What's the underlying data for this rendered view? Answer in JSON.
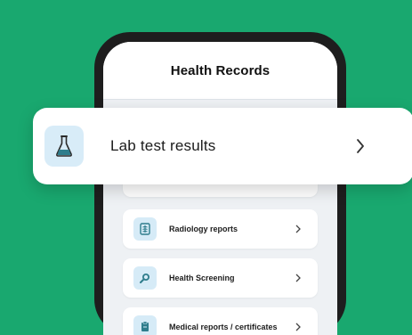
{
  "colors": {
    "background": "#19a86f",
    "phone_frame": "#1e1e1e",
    "icon_tile": "#d6ebf7",
    "icon_accent": "#2f7d8c"
  },
  "header": {
    "title": "Health Records"
  },
  "featured_item": {
    "label": "Lab test results",
    "icon": "flask-icon"
  },
  "list": {
    "items": [
      {
        "label": "Radiology reports",
        "icon": "xray-icon"
      },
      {
        "label": "Health Screening",
        "icon": "magnifier-icon"
      },
      {
        "label": "Medical reports / certificates",
        "icon": "document-icon"
      }
    ]
  }
}
